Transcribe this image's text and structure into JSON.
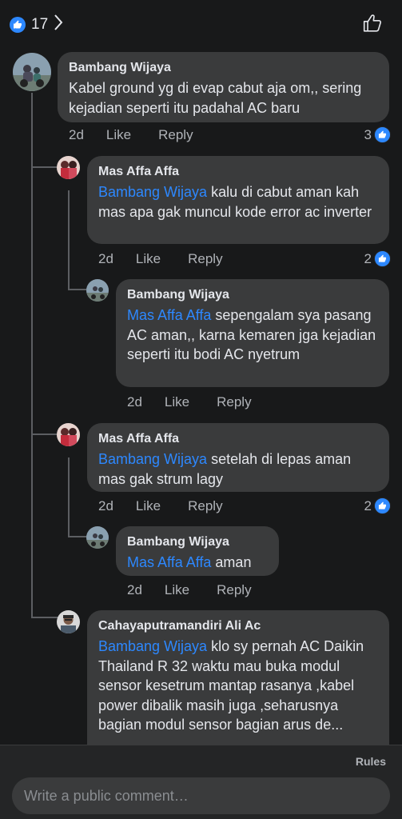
{
  "header": {
    "like_count": "17",
    "icons": {
      "like_badge": "thumbs-up-icon",
      "chevron": "chevron-right-icon",
      "like_button": "thumbs-up-outline-icon"
    }
  },
  "comments": [
    {
      "author": "Bambang Wijaya",
      "mention": "",
      "text": "Kabel ground yg di evap cabut aja om,, sering kejadian seperti itu padahal AC baru",
      "time": "2d",
      "like": "Like",
      "reply": "Reply",
      "reactions": "3"
    },
    {
      "author": "Mas Affa Affa",
      "mention": "Bambang Wijaya",
      "text": " kalu  di cabut aman kah mas apa gak muncul kode error ac inverter",
      "time": "2d",
      "like": "Like",
      "reply": "Reply",
      "reactions": "2"
    },
    {
      "author": "Bambang Wijaya",
      "mention": "Mas Affa Affa",
      "text": " sepengalam sya pasang AC aman,, karna kemaren jga kejadian seperti itu bodi AC nyetrum",
      "time": "2d",
      "like": "Like",
      "reply": "Reply",
      "reactions": ""
    },
    {
      "author": "Mas Affa Affa",
      "mention": "Bambang Wijaya",
      "text": " setelah di lepas aman mas gak strum lagy",
      "time": "2d",
      "like": "Like",
      "reply": "Reply",
      "reactions": "2"
    },
    {
      "author": "Bambang Wijaya",
      "mention": "Mas Affa Affa",
      "text": " aman",
      "time": "2d",
      "like": "Like",
      "reply": "Reply",
      "reactions": ""
    },
    {
      "author": "Cahayaputramandiri Ali Ac",
      "mention": "Bambang Wijaya",
      "text": " klo sy pernah AC Daikin Thailand R 32 waktu mau buka modul sensor kesetrum mantap rasanya  ,kabel power dibalik masih juga ,seharusnya bagian modul sensor bagian arus de...",
      "time": "",
      "like": "",
      "reply": "",
      "reactions": ""
    }
  ],
  "footer": {
    "rules": "Rules",
    "comment_placeholder": "Write a public comment…"
  },
  "colors": {
    "background": "#18191a",
    "bubble": "#3a3b3c",
    "mention": "#2d88ff",
    "like_blue": "#2d88ff"
  }
}
